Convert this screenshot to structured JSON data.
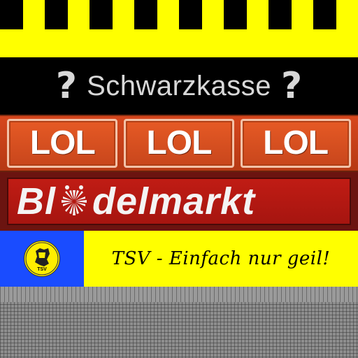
{
  "banners": {
    "schwarzkasse": {
      "title": "Schwarzkasse",
      "left_symbol": "?",
      "right_symbol": "?"
    },
    "lol": {
      "signs": [
        "LOL",
        "LOL",
        "LOL"
      ]
    },
    "bloedelmarkt": {
      "prefix": "Bl",
      "suffix": "delmarkt"
    },
    "tsv": {
      "slogan": "TSV - Einfach nur geil!",
      "logo_label": "TSV"
    }
  },
  "colors": {
    "stripe_yellow": "#ffff00",
    "stripe_black": "#000000",
    "lol_orange": "#d6471d",
    "bloedel_red": "#c01c14",
    "tsv_blue": "#1a4cff",
    "tsv_yellow": "#ffff00"
  }
}
